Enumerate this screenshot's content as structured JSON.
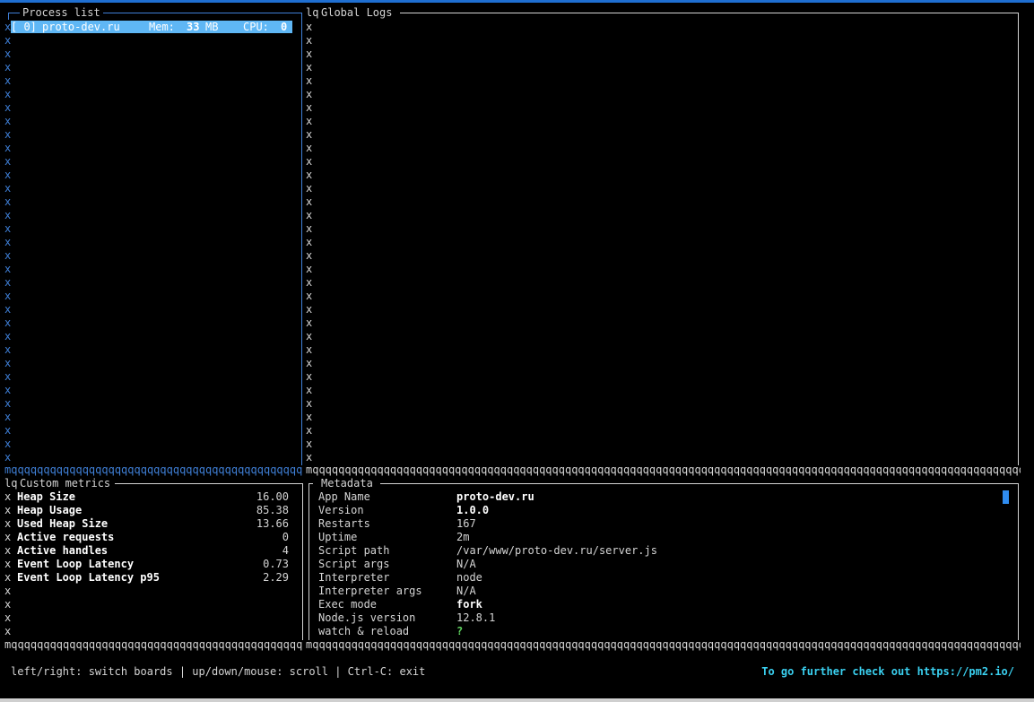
{
  "process_list": {
    "title": "Process list",
    "selected": {
      "index": "[ 0]",
      "name": "proto-dev.ru",
      "mem_label": "Mem:",
      "mem_value": "33",
      "mem_unit": "MB",
      "cpu_label": "CPU:",
      "cpu_value": "0"
    }
  },
  "global_logs": {
    "title": "Global Logs",
    "corner": "lq"
  },
  "custom_metrics": {
    "title": "Custom metrics",
    "corner": "lq",
    "rows": [
      {
        "name": "Heap Size",
        "value": "16.00"
      },
      {
        "name": "Heap Usage",
        "value": "85.38"
      },
      {
        "name": "Used Heap Size",
        "value": "13.66"
      },
      {
        "name": "Active requests",
        "value": "0"
      },
      {
        "name": "Active handles",
        "value": "4"
      },
      {
        "name": "Event Loop Latency",
        "value": "0.73"
      },
      {
        "name": "Event Loop Latency p95",
        "value": "2.29"
      }
    ]
  },
  "metadata": {
    "title": "Metadata",
    "rows": [
      {
        "key": "App Name",
        "value": "proto-dev.ru"
      },
      {
        "key": "Version",
        "value": "1.0.0"
      },
      {
        "key": "Restarts",
        "value": "167"
      },
      {
        "key": "Uptime",
        "value": "2m"
      },
      {
        "key": "Script path",
        "value": "/var/www/proto-dev.ru/server.js"
      },
      {
        "key": "Script args",
        "value": "N/A"
      },
      {
        "key": "Interpreter",
        "value": "node"
      },
      {
        "key": "Interpreter args",
        "value": "N/A"
      },
      {
        "key": "Exec mode",
        "value": "fork"
      },
      {
        "key": "Node.js version",
        "value": "12.8.1"
      },
      {
        "key": "watch & reload",
        "value": "?"
      }
    ]
  },
  "border_glyphs": {
    "side": "x",
    "bottom_fill": "q",
    "bottom_left": "m",
    "bottom_right": "j"
  },
  "footer": {
    "help": "left/right: switch boards | up/down/mouse: scroll | Ctrl-C: exit",
    "further": "To go further check out https://pm2.io/"
  },
  "colors": {
    "accent_blue": "#3f7fd6",
    "selection": "#5fb7f5",
    "link_cyan": "#3ad0f0",
    "cursor": "#2f8cf0"
  }
}
